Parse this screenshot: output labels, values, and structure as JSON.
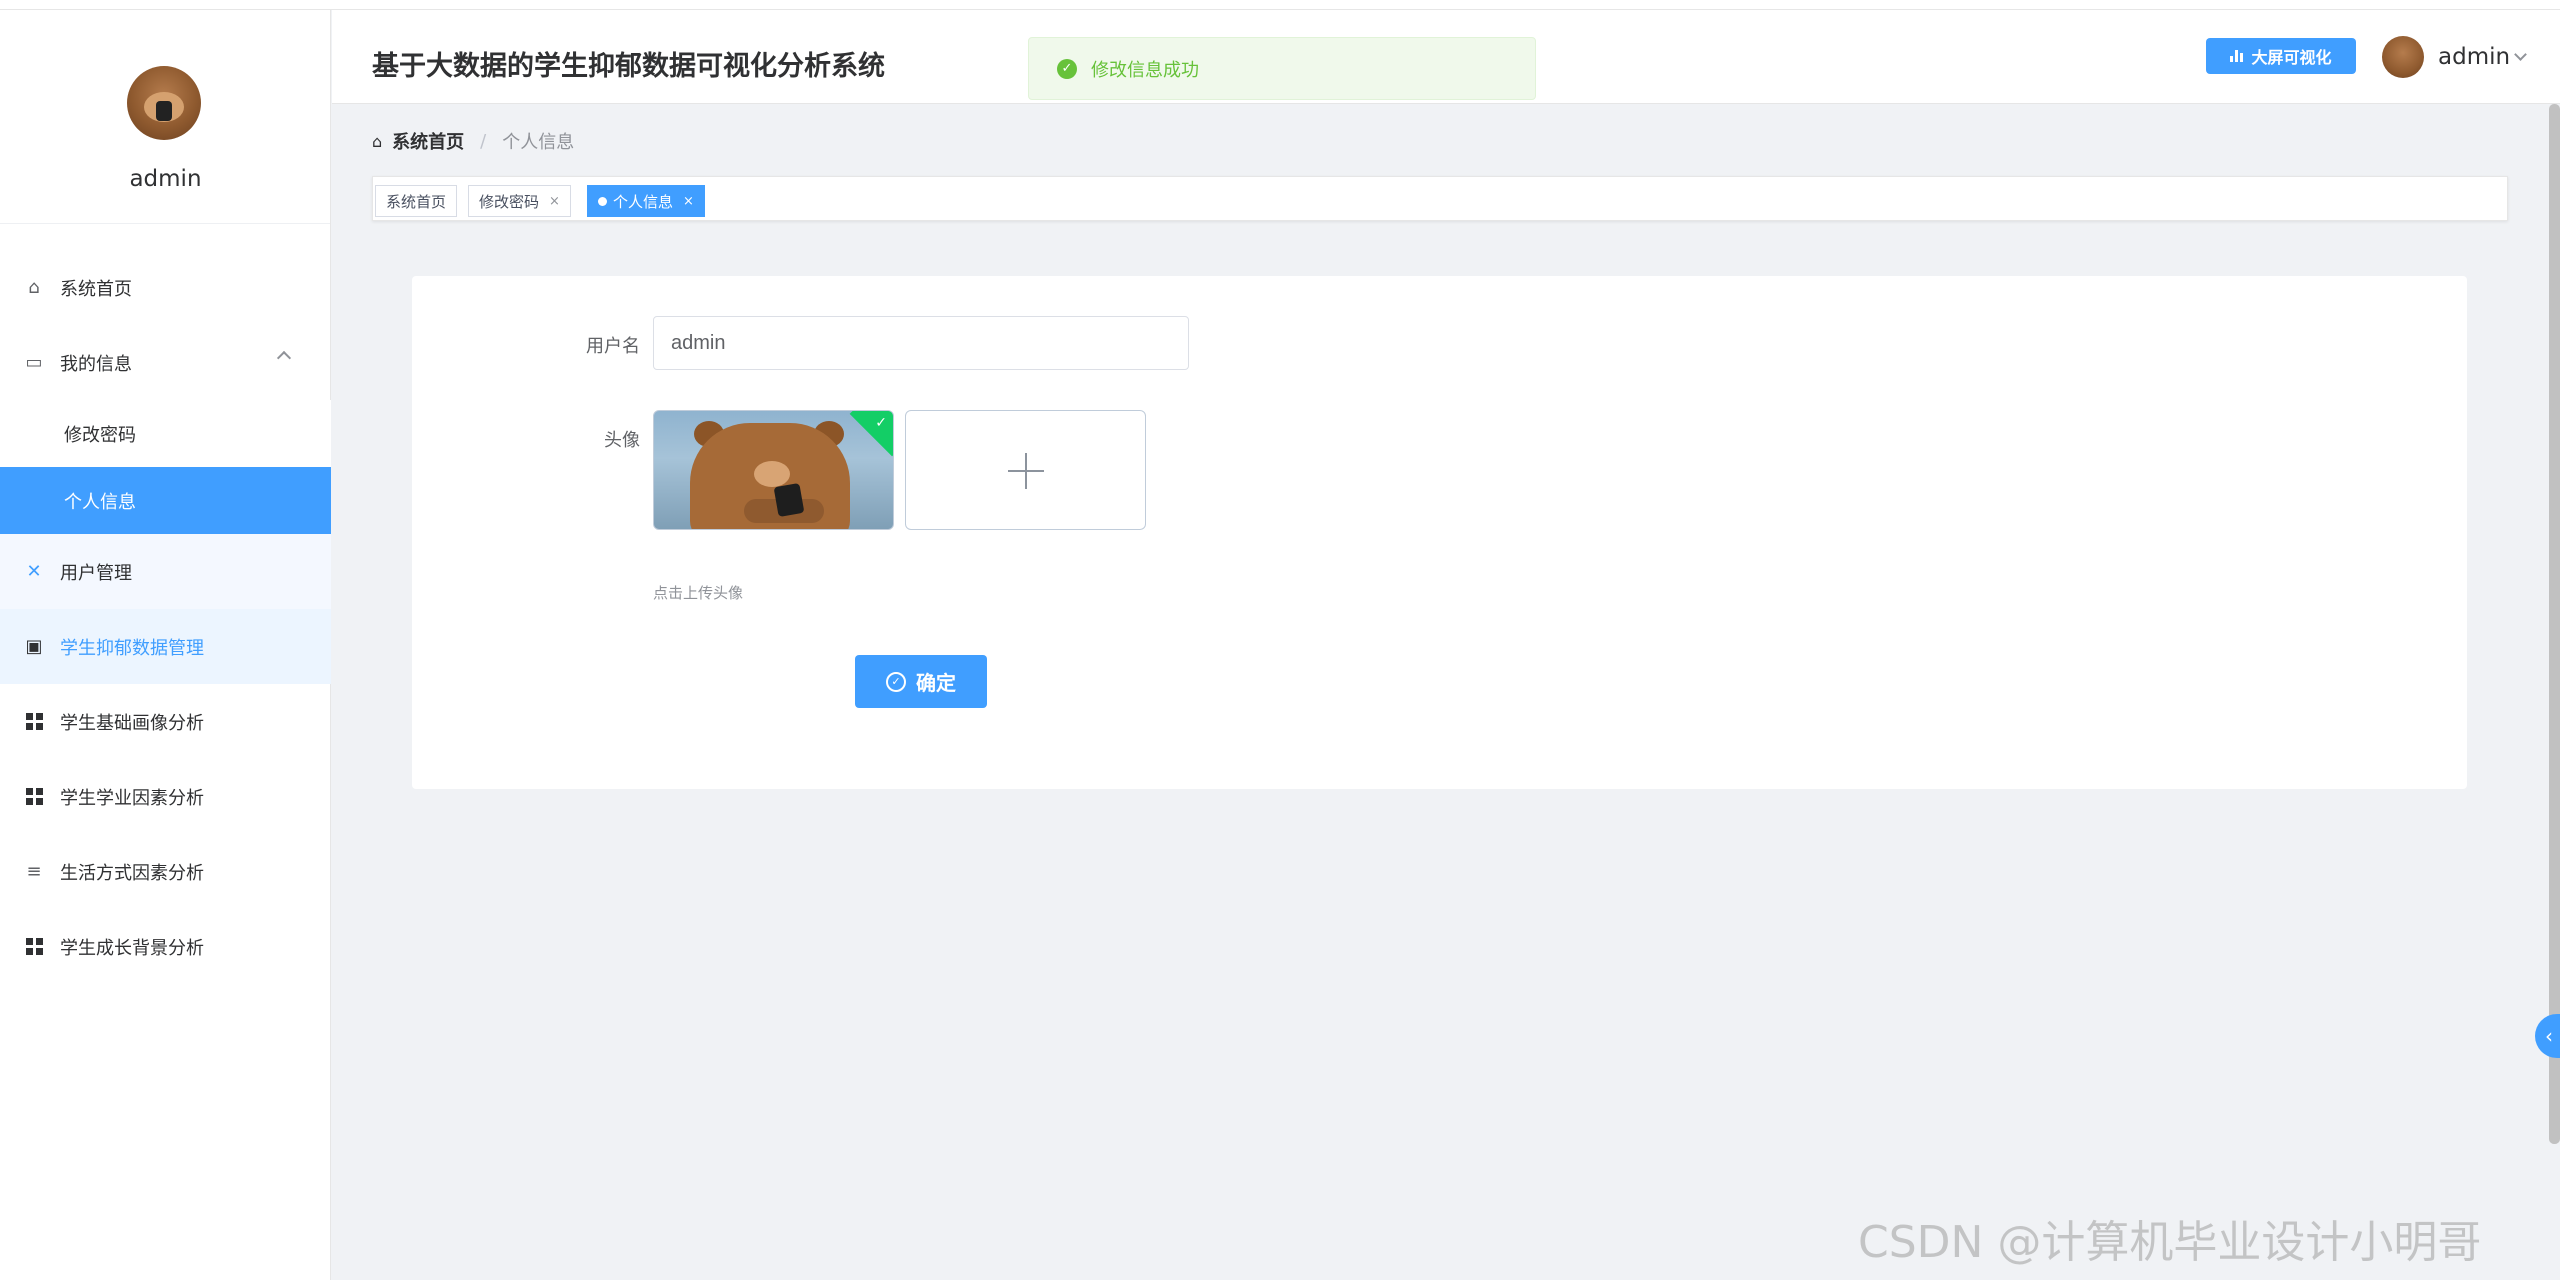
{
  "app": {
    "title": "基于大数据的学生抑郁数据可视化分析系统"
  },
  "toast": {
    "message": "修改信息成功"
  },
  "header": {
    "bigscreen_label": "大屏可视化",
    "user_name": "admin"
  },
  "sidebar": {
    "profile_name": "admin",
    "items": [
      {
        "label": "系统首页",
        "icon": "home-icon"
      },
      {
        "label": "我的信息",
        "icon": "calendar-icon"
      },
      {
        "label": "修改密码"
      },
      {
        "label": "个人信息"
      },
      {
        "label": "用户管理",
        "icon": "users-icon"
      },
      {
        "label": "学生抑郁数据管理",
        "icon": "clipboard-icon"
      },
      {
        "label": "学生基础画像分析",
        "icon": "grid-icon"
      },
      {
        "label": "学生学业因素分析",
        "icon": "grid-icon"
      },
      {
        "label": "生活方式因素分析",
        "icon": "sliders-icon"
      },
      {
        "label": "学生成长背景分析",
        "icon": "grid-icon"
      }
    ]
  },
  "breadcrumb": {
    "home": "系统首页",
    "current": "个人信息"
  },
  "tags": [
    {
      "label": "系统首页"
    },
    {
      "label": "修改密码",
      "close": "×"
    },
    {
      "label": "个人信息",
      "close": "×"
    }
  ],
  "form": {
    "username_label": "用户名",
    "username_value": "admin",
    "avatar_label": "头像",
    "upload_hint": "点击上传头像",
    "confirm_label": "确定"
  },
  "watermark": "CSDN @计算机毕业设计小明哥",
  "colors": {
    "primary": "#409eff",
    "success": "#67c23a",
    "active_bg": "#409eff"
  }
}
